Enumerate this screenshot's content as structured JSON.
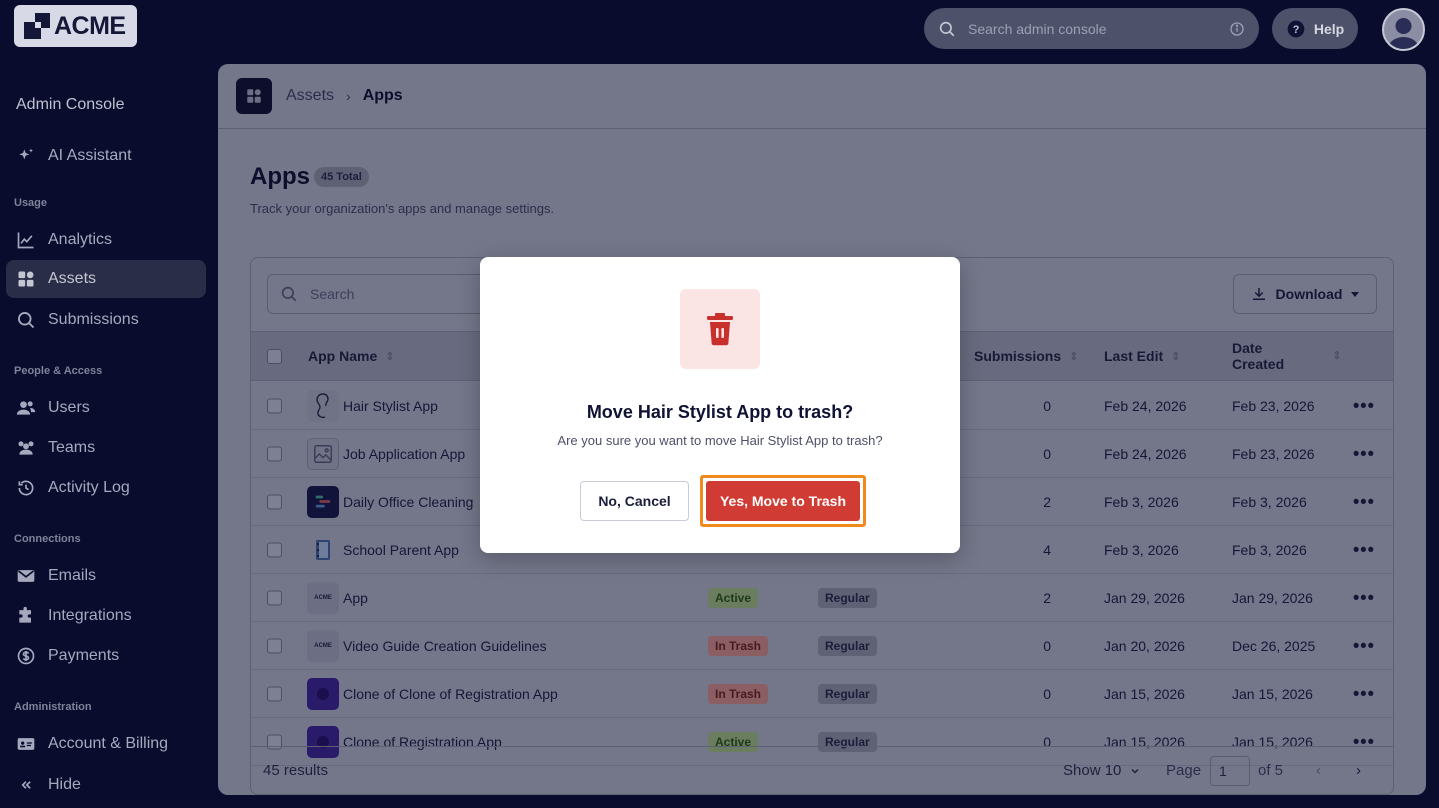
{
  "brand": {
    "logo_text": "ACME"
  },
  "topbar": {
    "search_placeholder": "Search admin console",
    "help_label": "Help"
  },
  "sidebar": {
    "title": "Admin Console",
    "ai_assistant": "AI Assistant",
    "sections": {
      "usage": "Usage",
      "people": "People & Access",
      "connections": "Connections",
      "administration": "Administration"
    },
    "items": {
      "analytics": "Analytics",
      "assets": "Assets",
      "submissions": "Submissions",
      "users": "Users",
      "teams": "Teams",
      "activity_log": "Activity Log",
      "emails": "Emails",
      "integrations": "Integrations",
      "payments": "Payments",
      "account_billing": "Account & Billing",
      "hide": "Hide"
    }
  },
  "breadcrumb": {
    "assets": "Assets",
    "separator": "›",
    "apps": "Apps"
  },
  "page": {
    "title": "Apps",
    "total_badge": "45 Total",
    "subtitle": "Track your organization's apps and manage settings."
  },
  "table": {
    "search_placeholder": "Search",
    "download_label": "Download",
    "headers": {
      "app_name": "App Name",
      "submissions": "Submissions",
      "last_edit": "Last Edit",
      "date_created_1": "Date",
      "date_created_2": "Created"
    },
    "rows": [
      {
        "name": "Hair Stylist App",
        "status": "",
        "type": "",
        "submissions": "0",
        "last_edit": "Feb 24, 2026",
        "created": "Feb 23, 2026"
      },
      {
        "name": "Job Application App",
        "status": "",
        "type": "",
        "submissions": "0",
        "last_edit": "Feb 24, 2026",
        "created": "Feb 23, 2026"
      },
      {
        "name": "Daily Office Cleaning",
        "status": "",
        "type": "",
        "submissions": "2",
        "last_edit": "Feb 3, 2026",
        "created": "Feb 3, 2026"
      },
      {
        "name": "School Parent App",
        "status": "",
        "type": "",
        "submissions": "4",
        "last_edit": "Feb 3, 2026",
        "created": "Feb 3, 2026"
      },
      {
        "name": "App",
        "status": "Active",
        "type": "Regular",
        "submissions": "2",
        "last_edit": "Jan 29, 2026",
        "created": "Jan 29, 2026"
      },
      {
        "name": "Video Guide Creation Guidelines",
        "status": "In Trash",
        "type": "Regular",
        "submissions": "0",
        "last_edit": "Jan 20, 2026",
        "created": "Dec 26, 2025"
      },
      {
        "name": "Clone of Clone of Registration App",
        "status": "In Trash",
        "type": "Regular",
        "submissions": "0",
        "last_edit": "Jan 15, 2026",
        "created": "Jan 15, 2026"
      },
      {
        "name": "Clone of Registration App",
        "status": "Active",
        "type": "Regular",
        "submissions": "0",
        "last_edit": "Jan 15, 2026",
        "created": "Jan 15, 2026"
      }
    ],
    "more_glyph": "•••",
    "icon_text_acme": "ACME"
  },
  "footer": {
    "results": "45 results",
    "show": "Show 10",
    "page_label": "Page",
    "page_value": "1",
    "of_label": "of 5",
    "prev": "‹",
    "next": "›"
  },
  "modal": {
    "title": "Move Hair Stylist App to trash?",
    "message": "Are you sure you want to move Hair Stylist App to trash?",
    "cancel_label": "No, Cancel",
    "confirm_label": "Yes, Move to Trash",
    "confirm_color": "#d03b34",
    "highlight_color": "#f08a1a"
  }
}
